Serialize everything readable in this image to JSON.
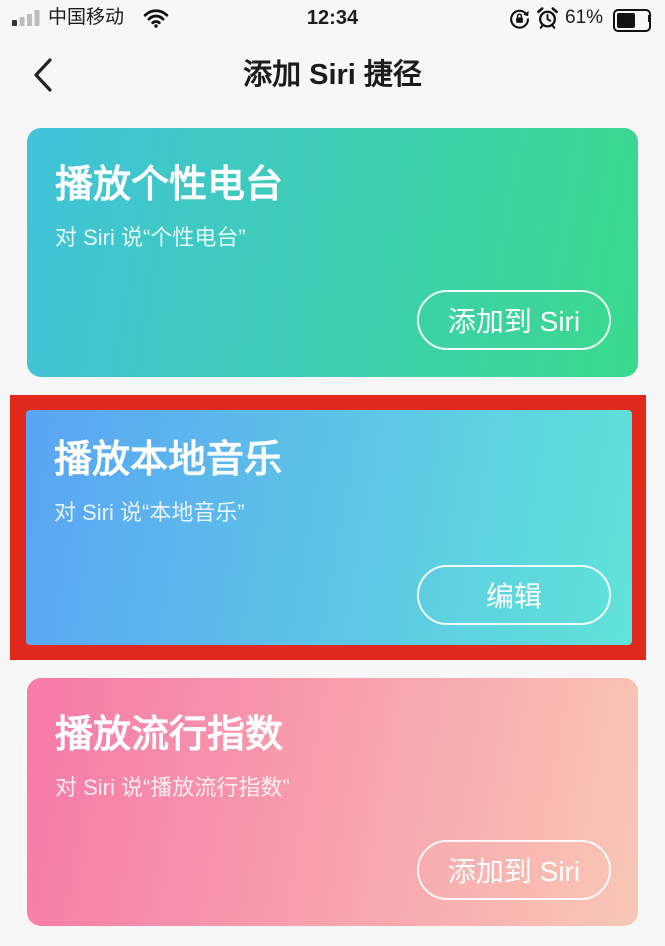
{
  "status_bar": {
    "carrier": "中国移动",
    "time": "12:34",
    "battery_text": "61%",
    "battery_level": 0.61,
    "icons": {
      "signal": "signal-icon",
      "wifi": "wifi-icon",
      "orientation_lock": "orientation-lock-icon",
      "alarm": "alarm-icon",
      "battery": "battery-icon"
    }
  },
  "nav": {
    "title": "添加 Siri 捷径",
    "back_icon": "chevron-left-icon"
  },
  "cards": [
    {
      "title": "播放个性电台",
      "subtitle": "对 Siri 说“个性电台”",
      "button": "添加到 Siri",
      "gradient": [
        "#41c2da",
        "#3ad98c"
      ]
    },
    {
      "title": "播放本地音乐",
      "subtitle": "对 Siri 说“本地音乐”",
      "button": "编辑",
      "gradient": [
        "#5aa4f4",
        "#5fe3d8"
      ],
      "highlighted": true
    },
    {
      "title": "播放流行指数",
      "subtitle": "对 Siri 说“播放流行指数”",
      "button": "添加到 Siri",
      "gradient": [
        "#f779a7",
        "#f8c7b5"
      ]
    }
  ],
  "colors": {
    "background": "#f7f7f7",
    "highlight": "#e1281c",
    "text_dark": "#1c1c1c"
  }
}
